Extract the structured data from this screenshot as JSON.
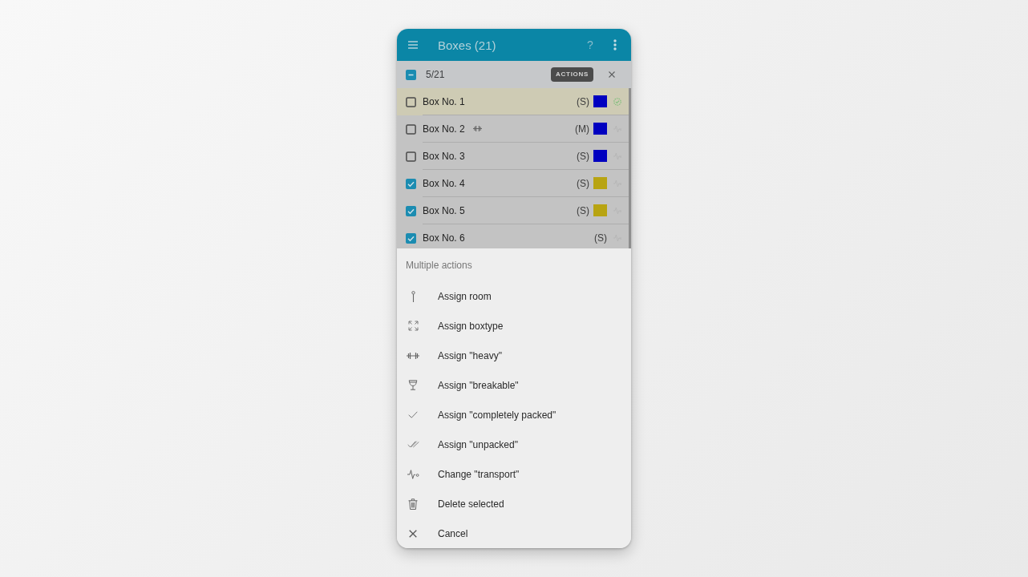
{
  "app_bar": {
    "title": "Boxes (21)",
    "help": "?"
  },
  "selection_bar": {
    "indeterminate": true,
    "count": "5/21",
    "actions": "ACTIONS"
  },
  "boxes": [
    {
      "name": "Box No. 1",
      "size": "(S)",
      "color": "#0000c0",
      "checked": false,
      "highlighted": true,
      "heavy": false,
      "packed": true
    },
    {
      "name": "Box No. 2",
      "size": "(M)",
      "color": "#0000c0",
      "checked": false,
      "highlighted": false,
      "heavy": true,
      "packed": false
    },
    {
      "name": "Box No. 3",
      "size": "(S)",
      "color": "#0000c0",
      "checked": false,
      "highlighted": false,
      "heavy": false,
      "packed": false
    },
    {
      "name": "Box No. 4",
      "size": "(S)",
      "color": "#b8a412",
      "checked": true,
      "highlighted": false,
      "heavy": false,
      "packed": false
    },
    {
      "name": "Box No. 5",
      "size": "(S)",
      "color": "#b8a412",
      "checked": true,
      "highlighted": false,
      "heavy": false,
      "packed": false
    },
    {
      "name": "Box No. 6",
      "size": "(S)",
      "checked": true,
      "highlighted": false,
      "heavy": false,
      "packed": false
    }
  ],
  "action_sheet": {
    "title": "Multiple actions",
    "actions": [
      {
        "kind": "room",
        "label": "Assign room"
      },
      {
        "kind": "boxtype",
        "label": "Assign boxtype"
      },
      {
        "kind": "heavy",
        "label": "Assign \"heavy\""
      },
      {
        "kind": "breakable",
        "label": "Assign \"breakable\""
      },
      {
        "kind": "packed",
        "label": "Assign \"completely packed\""
      },
      {
        "kind": "unpacked",
        "label": "Assign \"unpacked\""
      },
      {
        "kind": "transport",
        "label": "Change \"transport\""
      },
      {
        "kind": "delete",
        "label": "Delete selected"
      },
      {
        "kind": "cancel",
        "label": "Cancel"
      }
    ]
  }
}
